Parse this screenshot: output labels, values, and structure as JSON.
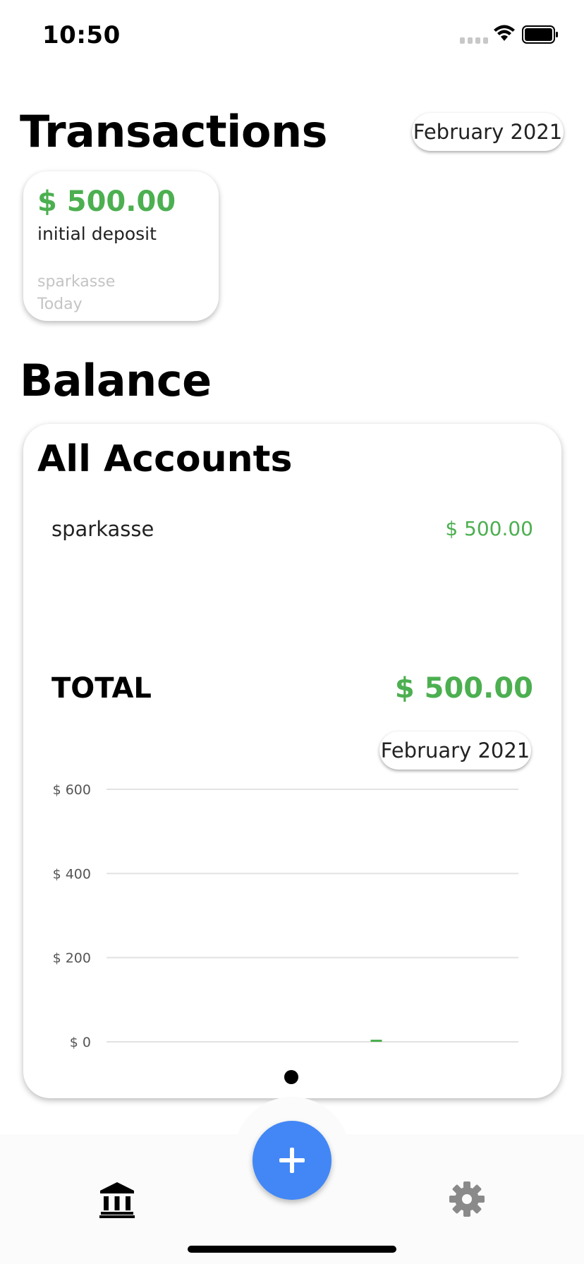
{
  "status_bar": {
    "time": "10:50"
  },
  "transactions": {
    "title": "Transactions",
    "month": "February 2021",
    "items": [
      {
        "amount": "$ 500.00",
        "description": "initial deposit",
        "account": "sparkasse",
        "date": "Today"
      }
    ]
  },
  "balance": {
    "title": "Balance",
    "card_title": "All Accounts",
    "accounts": [
      {
        "name": "sparkasse",
        "balance": "$ 500.00"
      }
    ],
    "total_label": "TOTAL",
    "total_value": "$ 500.00",
    "chart_month": "February 2021"
  },
  "chart_data": {
    "type": "bar",
    "y_ticks": [
      "$ 600",
      "$ 400",
      "$ 200",
      "$ 0"
    ],
    "y_tick_values": [
      600,
      400,
      200,
      0
    ],
    "ylim": [
      0,
      600
    ],
    "grid": true,
    "x_index_fraction": 0.655,
    "values": [
      0
    ],
    "bar_color": "#4caf50"
  },
  "colors": {
    "accent_green": "#4caf50",
    "fab_blue": "#4287f5"
  },
  "icons": {
    "fab": "plus-icon",
    "nav_left": "bank-icon",
    "nav_right": "gear-icon"
  }
}
